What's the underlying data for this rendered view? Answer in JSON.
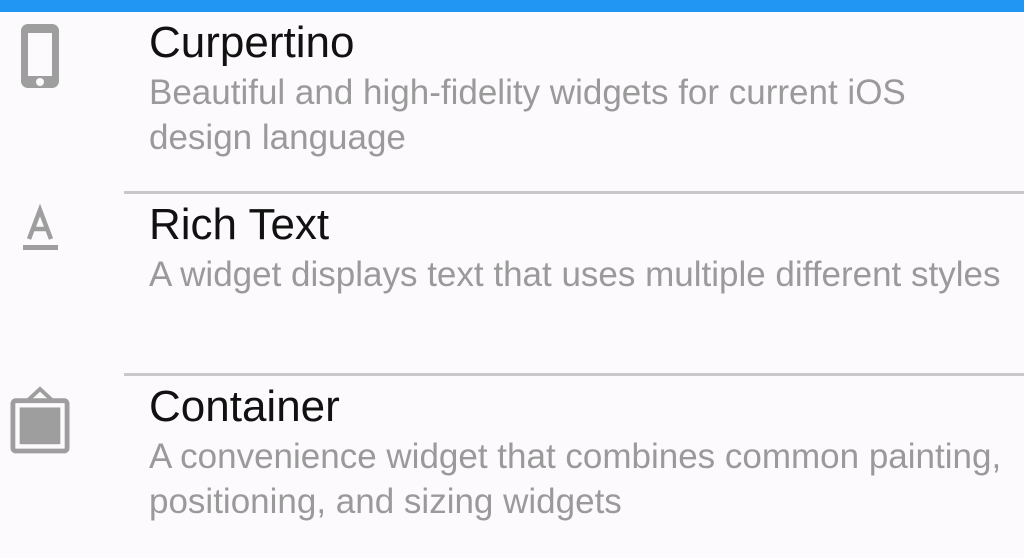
{
  "theme": {
    "accent": "#2196f3",
    "icon_color": "#9e9e9e",
    "title_color": "#111111",
    "subtitle_color": "#9a9a9a",
    "divider_color": "#c8c8c8"
  },
  "items": [
    {
      "icon": "phone-icon",
      "title": "Curpertino",
      "subtitle": "Beautiful and high-fidelity widgets for current iOS design language"
    },
    {
      "icon": "text-format-icon",
      "title": "Rich Text",
      "subtitle": "A widget displays text that uses multiple different styles"
    },
    {
      "icon": "container-icon",
      "title": "Container",
      "subtitle": "A convenience widget that combines common painting, positioning, and sizing widgets"
    }
  ]
}
